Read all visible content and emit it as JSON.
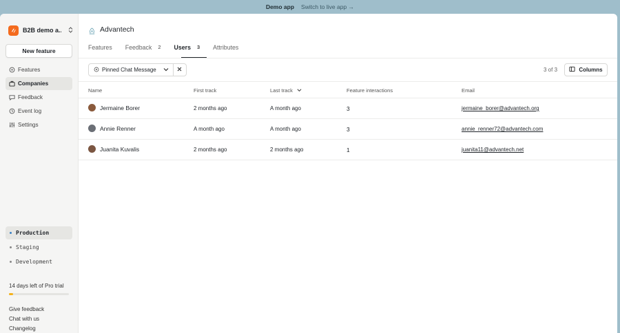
{
  "topbar": {
    "mode": "Demo app",
    "switch_label": "Switch to live app →"
  },
  "sidebar": {
    "org_name": "B2B demo a...",
    "new_feature_label": "New feature",
    "nav": [
      {
        "label": "Features",
        "icon": "features-icon",
        "active": false
      },
      {
        "label": "Companies",
        "icon": "companies-icon",
        "active": true
      },
      {
        "label": "Feedback",
        "icon": "feedback-icon",
        "active": false
      },
      {
        "label": "Event log",
        "icon": "event-log-icon",
        "active": false
      },
      {
        "label": "Settings",
        "icon": "settings-icon",
        "active": false
      }
    ],
    "environments": [
      {
        "label": "Production",
        "active": true
      },
      {
        "label": "Staging",
        "active": false
      },
      {
        "label": "Development",
        "active": false
      }
    ],
    "trial_text": "14 days left of Pro trial",
    "trial_progress": 0.07,
    "footer_links": [
      "Give feedback",
      "Chat with us",
      "Changelog"
    ]
  },
  "company": {
    "name": "Advantech"
  },
  "tabs": [
    {
      "label": "Features",
      "count": ""
    },
    {
      "label": "Feedback",
      "count": "2"
    },
    {
      "label": "Users",
      "count": "3"
    },
    {
      "label": "Attributes",
      "count": ""
    }
  ],
  "filter": {
    "label": "Pinned Chat Message"
  },
  "pager": "3 of 3",
  "columns_label": "Columns",
  "table": {
    "headers": [
      "Name",
      "First track",
      "Last track",
      "Feature interactions",
      "Email"
    ],
    "rows": [
      {
        "name": "Jermaine Borer",
        "first_track": "2 months ago",
        "last_track": "A month ago",
        "interactions": "3",
        "email": "jermaine_borer@advantech.org"
      },
      {
        "name": "Annie Renner",
        "first_track": "A month ago",
        "last_track": "A month ago",
        "interactions": "3",
        "email": "annie_renner72@advantech.com"
      },
      {
        "name": "Juanita Kuvalis",
        "first_track": "2 months ago",
        "last_track": "2 months ago",
        "interactions": "1",
        "email": "juanita11@advantech.net"
      }
    ]
  },
  "colors": {
    "accent": "#f46b1e",
    "topbar": "#9fbecb",
    "trial": "#f5b21b"
  }
}
